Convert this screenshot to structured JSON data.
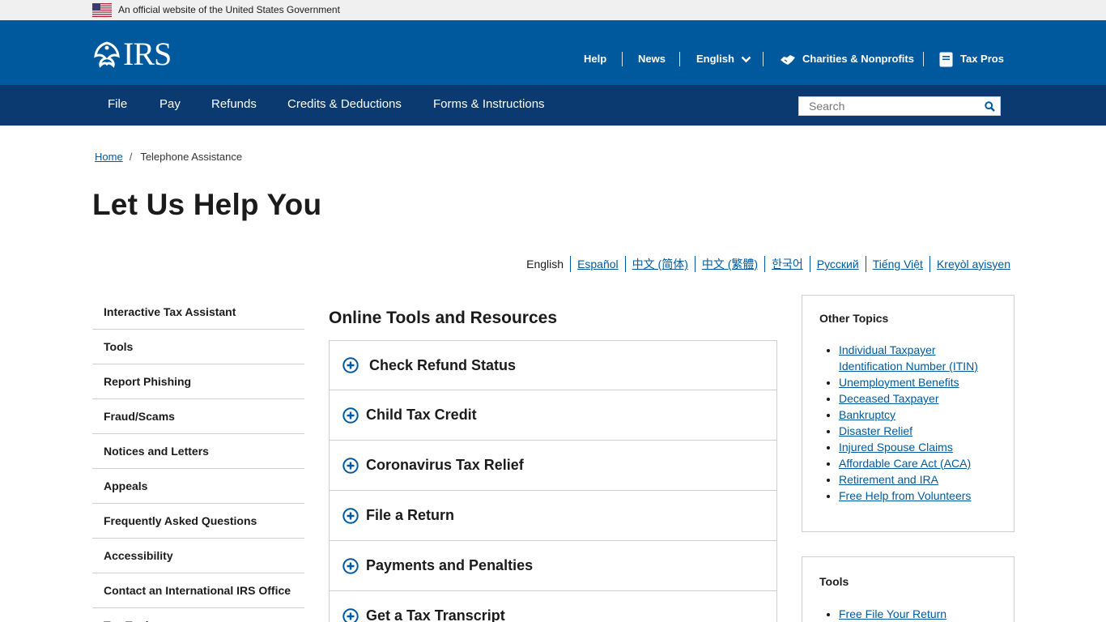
{
  "gov_banner": {
    "text": "An official website of the United States Government"
  },
  "header": {
    "logo_text": "IRS",
    "utility_links": {
      "help": "Help",
      "news": "News",
      "language": "English",
      "charities": "Charities & Nonprofits",
      "tax_pros": "Tax Pros"
    }
  },
  "nav": {
    "items": [
      "File",
      "Pay",
      "Refunds",
      "Credits & Deductions",
      "Forms & Instructions"
    ],
    "search_placeholder": "Search"
  },
  "breadcrumb": {
    "home": "Home",
    "current": "Telephone Assistance"
  },
  "page_title": "Let Us Help You",
  "languages": [
    "English",
    "Español",
    "中文 (简体)",
    "中文 (繁體)",
    "한국어",
    "Русский",
    "Tiếng Việt",
    "Kreyòl ayisyen"
  ],
  "sidebar": {
    "items": [
      "Interactive Tax Assistant",
      "Tools",
      "Report Phishing",
      "Fraud/Scams",
      "Notices and Letters",
      "Appeals",
      "Frequently Asked Questions",
      "Accessibility",
      "Contact an International IRS Office",
      "Tax Tools"
    ]
  },
  "main": {
    "section_title": "Online Tools and Resources",
    "accordion": [
      "Check Refund Status",
      "Child Tax Credit",
      "Coronavirus Tax Relief",
      "File a Return",
      "Payments and Penalties",
      "Get a Tax Transcript"
    ]
  },
  "other_topics": {
    "title": "Other Topics",
    "links": [
      "Individual Taxpayer Identification Number (ITIN)",
      "Unemployment Benefits",
      "Deceased Taxpayer",
      "Bankruptcy",
      "Disaster Relief",
      "Injured Spouse Claims",
      "Affordable Care Act (ACA)",
      "Retirement and IRA",
      "Free Help from Volunteers"
    ]
  },
  "tools_box": {
    "title": "Tools",
    "links": [
      "Free File Your Return"
    ]
  },
  "colors": {
    "header_blue": "#00599c",
    "nav_navy": "#0b3a70",
    "link_blue": "#00599c",
    "banner_gray": "#f0f0f0"
  }
}
